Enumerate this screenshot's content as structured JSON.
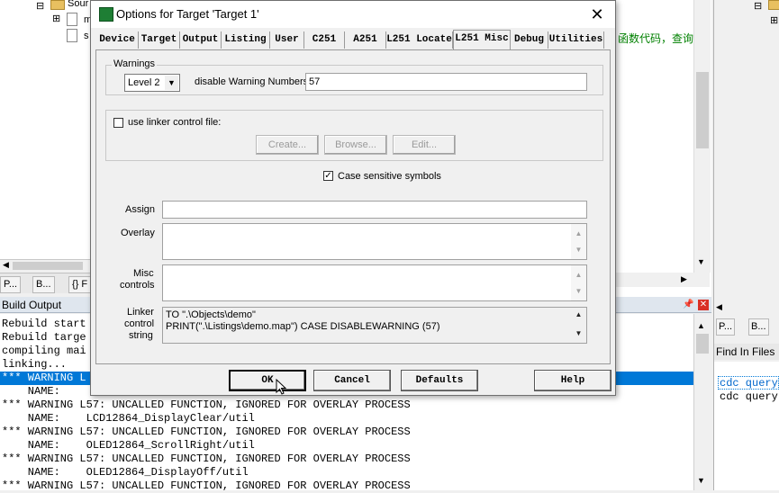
{
  "background": {
    "tree_item_root": "Sour",
    "tree_item_1": "m",
    "tree_item_2": "s",
    "left_tab_1": "P...",
    "left_tab_2": "B...",
    "left_tab_3": "{} F",
    "editor_chinese_text": "函数代码，查询",
    "build_output": {
      "title": "Build Output",
      "lines": [
        "Rebuild start",
        "Rebuild targe",
        "compiling mai",
        "linking...",
        "*** WARNING L",
        "    NAME:    ",
        "*** WARNING L57: UNCALLED FUNCTION, IGNORED FOR OVERLAY PROCESS",
        "    NAME:    LCD12864_DisplayClear/util",
        "*** WARNING L57: UNCALLED FUNCTION, IGNORED FOR OVERLAY PROCESS",
        "    NAME:    OLED12864_ScrollRight/util",
        "*** WARNING L57: UNCALLED FUNCTION, IGNORED FOR OVERLAY PROCESS",
        "    NAME:    OLED12864_DisplayOff/util",
        "*** WARNING L57: UNCALLED FUNCTION, IGNORED FOR OVERLAY PROCESS"
      ]
    },
    "right_tab_1": "P...",
    "right_tab_2": "B...",
    "find_in_files": {
      "title": "Find In Files",
      "lines": [
        "cdc query",
        "cdc query"
      ]
    }
  },
  "dialog": {
    "title": "Options for Target 'Target 1'",
    "tabs": [
      "Device",
      "Target",
      "Output",
      "Listing",
      "User",
      "C251",
      "A251",
      "L251 Locate",
      "L251 Misc",
      "Debug",
      "Utilities"
    ],
    "active_tab": "L251 Misc",
    "warnings_group_label": "Warnings",
    "warning_level": "Level 2",
    "disable_warning_label": "disable Warning Numbers:",
    "disable_warning_value": "57",
    "use_linker_control_label": "use linker control file:",
    "use_linker_control_checked": false,
    "create_button": "Create...",
    "browse_button": "Browse...",
    "edit_button": "Edit...",
    "case_sensitive_label": "Case sensitive symbols",
    "case_sensitive_checked": true,
    "assign_label": "Assign",
    "assign_value": "",
    "overlay_label": "Overlay",
    "misc_controls_label_1": "Misc",
    "misc_controls_label_2": "controls",
    "linker_control_label_1": "Linker",
    "linker_control_label_2": "control",
    "linker_control_label_3": "string",
    "linker_control_string_lines": [
      "TO \".\\Objects\\demo\"",
      "PRINT(\".\\Listings\\demo.map\") CASE DISABLEWARNING (57)"
    ],
    "ok_button": "OK",
    "cancel_button": "Cancel",
    "defaults_button": "Defaults",
    "help_button": "Help"
  }
}
